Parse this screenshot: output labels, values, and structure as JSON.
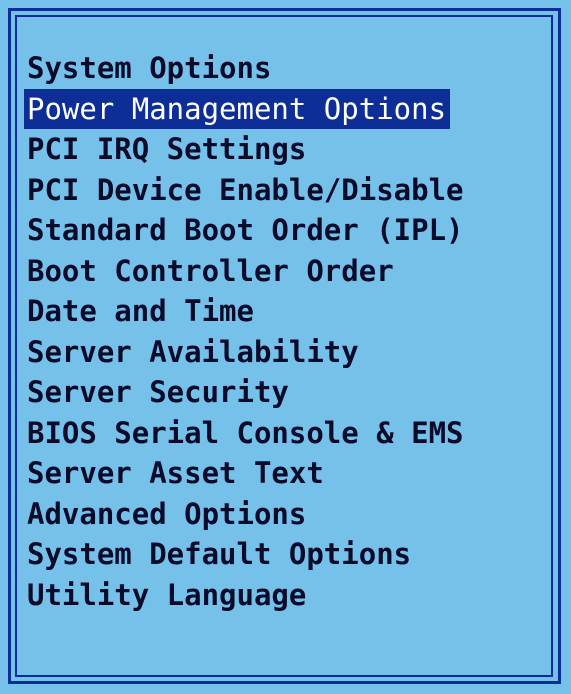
{
  "menu": {
    "selected_index": 1,
    "items": [
      {
        "label": "System Options"
      },
      {
        "label": "Power Management Options"
      },
      {
        "label": "PCI IRQ Settings"
      },
      {
        "label": "PCI Device Enable/Disable"
      },
      {
        "label": "Standard Boot Order (IPL)"
      },
      {
        "label": "Boot Controller Order"
      },
      {
        "label": "Date and Time"
      },
      {
        "label": "Server Availability"
      },
      {
        "label": "Server Security"
      },
      {
        "label": "BIOS Serial Console & EMS"
      },
      {
        "label": "Server Asset Text"
      },
      {
        "label": "Advanced Options"
      },
      {
        "label": "System Default Options"
      },
      {
        "label": "Utility Language"
      }
    ]
  },
  "colors": {
    "background": "#76c1e9",
    "border": "#0c2e96",
    "highlight": "#0c2e96",
    "text": "#0a0a2a",
    "highlight_text": "#ffffff"
  }
}
